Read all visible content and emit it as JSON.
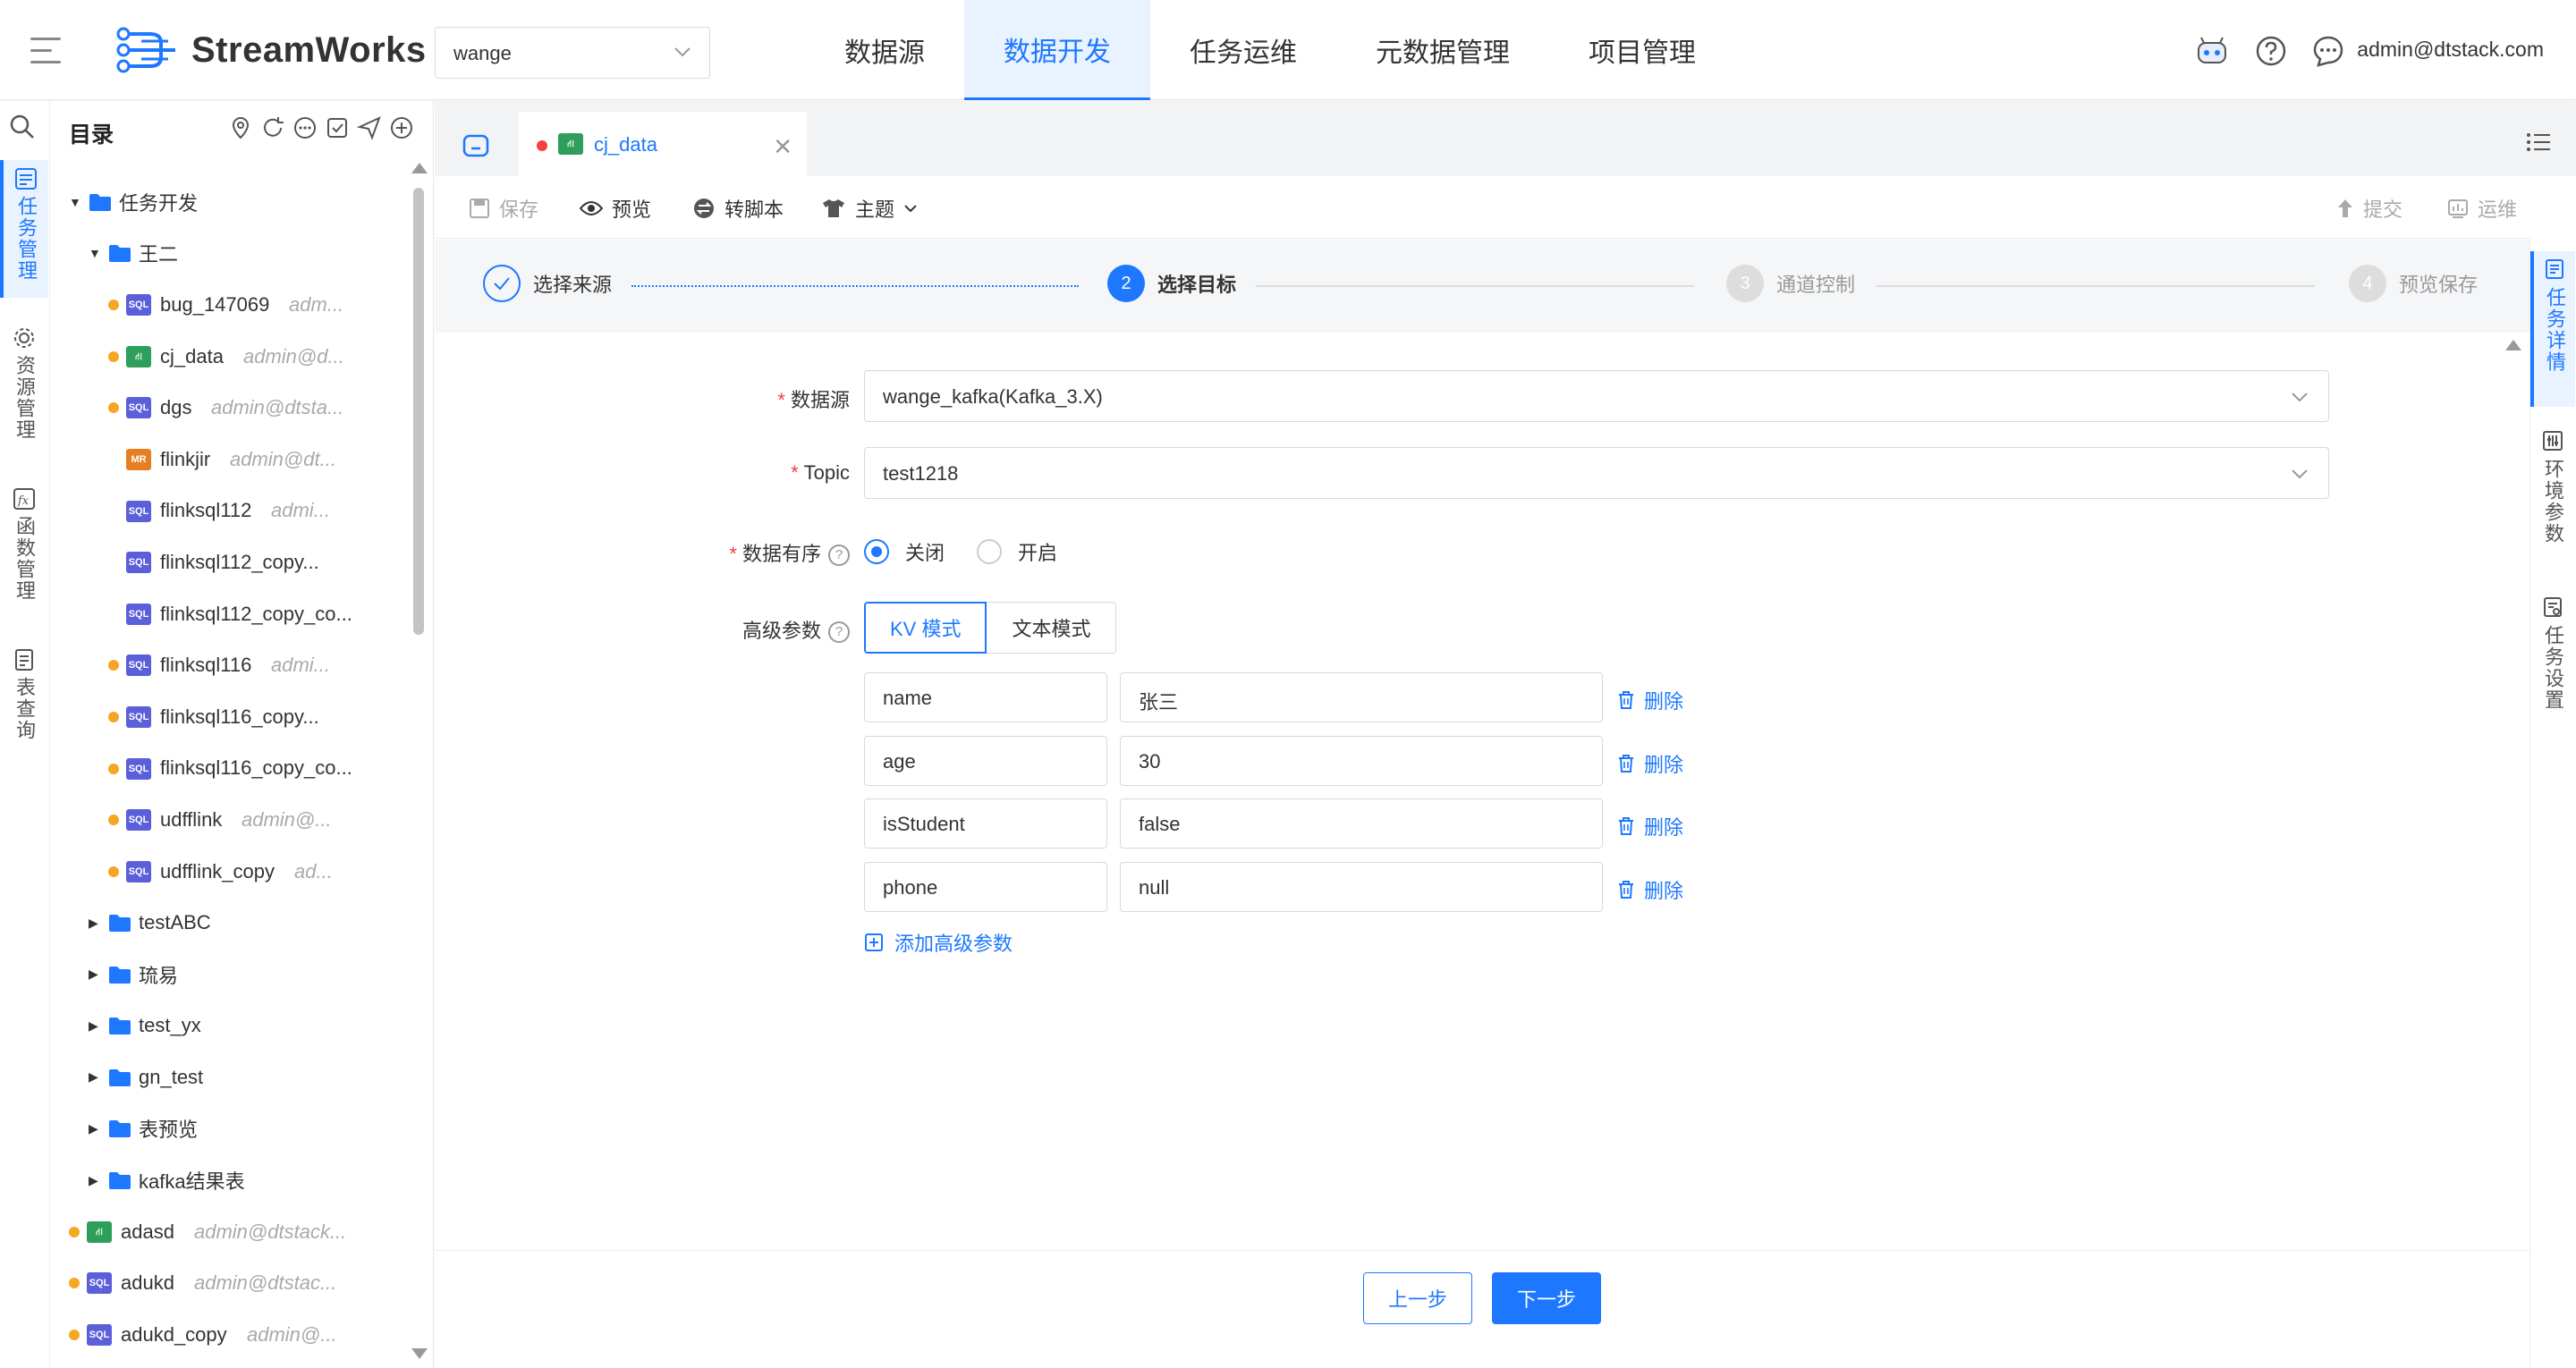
{
  "header": {
    "brand": "StreamWorks",
    "project_select": "wange",
    "nav": [
      "数据源",
      "数据开发",
      "任务运维",
      "元数据管理",
      "项目管理"
    ],
    "active_nav": 1,
    "user": "admin@dtstack.com",
    "accent": "#1d78ff"
  },
  "rail": {
    "items": [
      "任务管理",
      "资源管理",
      "函数管理",
      "表查询"
    ]
  },
  "tree": {
    "title": "目录",
    "rows": [
      {
        "label": "任务开发",
        "type": "folder",
        "level": 0,
        "caret": "down"
      },
      {
        "label": "王二",
        "type": "folder",
        "level": 1,
        "caret": "down"
      },
      {
        "label": "bug_147069",
        "owner": "adm...",
        "type": "sql",
        "level": 2,
        "dot": true
      },
      {
        "label": "cj_data",
        "owner": "admin@d...",
        "type": "flow",
        "level": 2,
        "dot": true
      },
      {
        "label": "dgs",
        "owner": "admin@dtsta...",
        "type": "sql",
        "level": 2,
        "dot": true
      },
      {
        "label": "flinkjir",
        "owner": "admin@dt...",
        "type": "mr",
        "level": 2,
        "dot": false
      },
      {
        "label": "flinksql112",
        "owner": "admi...",
        "type": "sql",
        "level": 2,
        "dot": false
      },
      {
        "label": "flinksql112_copy...",
        "owner": "",
        "type": "sql",
        "level": 2,
        "dot": false
      },
      {
        "label": "flinksql112_copy_co...",
        "owner": "",
        "type": "sql",
        "level": 2,
        "dot": false
      },
      {
        "label": "flinksql116",
        "owner": "admi...",
        "type": "sql",
        "level": 2,
        "dot": true
      },
      {
        "label": "flinksql116_copy...",
        "owner": "",
        "type": "sql",
        "level": 2,
        "dot": true
      },
      {
        "label": "flinksql116_copy_co...",
        "owner": "",
        "type": "sql",
        "level": 2,
        "dot": true
      },
      {
        "label": "udfflink",
        "owner": "admin@...",
        "type": "sql",
        "level": 2,
        "dot": true
      },
      {
        "label": "udfflink_copy",
        "owner": "ad...",
        "type": "sql",
        "level": 2,
        "dot": true
      },
      {
        "label": "testABC",
        "type": "folder",
        "level": 1,
        "caret": "right"
      },
      {
        "label": "琉易",
        "type": "folder",
        "level": 1,
        "caret": "right"
      },
      {
        "label": "test_yx",
        "type": "folder",
        "level": 1,
        "caret": "right"
      },
      {
        "label": "gn_test",
        "type": "folder",
        "level": 1,
        "caret": "right"
      },
      {
        "label": "表预览",
        "type": "folder",
        "level": 1,
        "caret": "right"
      },
      {
        "label": "kafka结果表",
        "type": "folder",
        "level": 1,
        "caret": "right"
      },
      {
        "label": "adasd",
        "owner": "admin@dtstack...",
        "type": "flow",
        "level": 0,
        "dot": true
      },
      {
        "label": "adukd",
        "owner": "admin@dtstac...",
        "type": "sql",
        "level": 0,
        "dot": true
      },
      {
        "label": "adukd_copy",
        "owner": "admin@...",
        "type": "sql",
        "level": 0,
        "dot": true
      }
    ]
  },
  "tab": {
    "name": "cj_data"
  },
  "toolbar": {
    "save": "保存",
    "preview": "预览",
    "convert": "转脚本",
    "theme": "主题",
    "submit": "提交",
    "ops": "运维"
  },
  "steps": [
    {
      "label": "选择来源",
      "num": "1",
      "state": "done"
    },
    {
      "label": "选择目标",
      "num": "2",
      "state": "active"
    },
    {
      "label": "通道控制",
      "num": "3",
      "state": "wait"
    },
    {
      "label": "预览保存",
      "num": "4",
      "state": "wait"
    }
  ],
  "right_panel": [
    "任务详情",
    "环境参数",
    "任务设置"
  ],
  "form": {
    "datasource_label": "数据源",
    "datasource_value": "wange_kafka(Kafka_3.X)",
    "topic_label": "Topic",
    "topic_value": "test1218",
    "order_label": "数据有序",
    "order_off": "关闭",
    "order_on": "开启",
    "order_selected": "off",
    "adv_label": "高级参数",
    "mode_kv": "KV 模式",
    "mode_text": "文本模式",
    "params": [
      {
        "key": "name",
        "value": "张三"
      },
      {
        "key": "age",
        "value": "30"
      },
      {
        "key": "isStudent",
        "value": "false"
      },
      {
        "key": "phone",
        "value": "null"
      }
    ],
    "delete_label": "删除",
    "add_label": "添加高级参数"
  },
  "footer": {
    "prev": "上一步",
    "next": "下一步"
  }
}
